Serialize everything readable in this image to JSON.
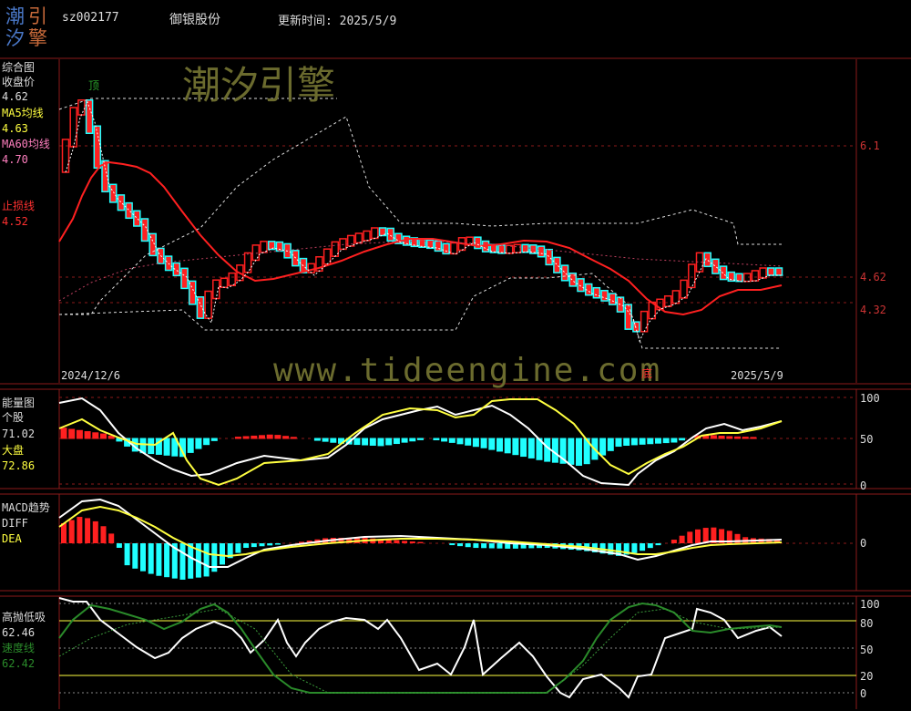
{
  "header": {
    "logo_chars": [
      "潮",
      "引",
      "汐",
      "擎"
    ],
    "stock_code": "sz002177",
    "stock_name": "御银股份",
    "update_label": "更新时间: 2025/5/9"
  },
  "watermark": {
    "brand": "潮汐引擎",
    "url": "www.tideengine.com"
  },
  "colors": {
    "red": "#ff2020",
    "cyan": "#20ffff",
    "yellow": "#ffff40",
    "white": "#ffffff",
    "green": "#2a8a2a",
    "grid": "#8b1a1a"
  },
  "panel_main": {
    "title": "综合图",
    "close_label": "收盘价",
    "close_value": "4.62",
    "ma5_label": "MA5均线",
    "ma5_value": "4.63",
    "ma60_label": "MA60均线",
    "ma60_value": "4.70",
    "stop_label": "止损线",
    "stop_value": "4.52",
    "axis": [
      "6.1",
      "4.62",
      "4.32"
    ],
    "top_marker": "顶",
    "bottom_marker": "底",
    "start_date": "2024/12/6",
    "end_date": "2025/5/9"
  },
  "panel_energy": {
    "title": "能量图",
    "stock_label": "个股",
    "stock_value": "71.02",
    "market_label": "大盘",
    "market_value": "72.86",
    "axis": [
      "100",
      "50",
      "0"
    ]
  },
  "panel_macd": {
    "title": "MACD趋势",
    "diff_label": "DIFF",
    "dea_label": "DEA",
    "axis": [
      "0"
    ]
  },
  "panel_kdj": {
    "title": "高抛低吸",
    "value1": "62.46",
    "speed_label": "速度线",
    "value2": "62.42",
    "axis": [
      "100",
      "80",
      "50",
      "20",
      "0"
    ]
  },
  "chart_data": {
    "type": "candlestick",
    "dates": [
      "2024/12/6",
      "2025/5/9"
    ],
    "last_close": 4.62,
    "ma5": 4.63,
    "ma60": 4.7,
    "stop_loss": 4.52,
    "price_levels": [
      6.1,
      4.62,
      4.32
    ]
  }
}
